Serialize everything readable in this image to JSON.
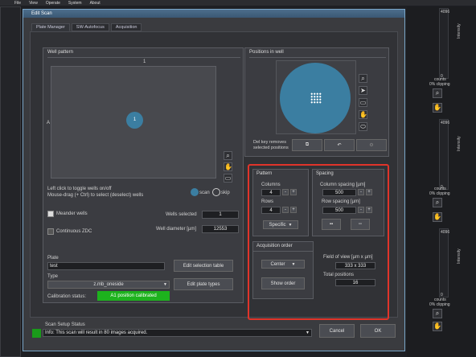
{
  "menu": [
    "File",
    "View",
    "Operate",
    "System",
    "About"
  ],
  "dialog_title": "Edit Scan",
  "tabs": [
    "Plate Manager",
    "SW-Autofocus",
    "Acquisition"
  ],
  "well_pattern": {
    "title": "Well pattern",
    "column_label": "1",
    "row_label": "A",
    "well_label": "1",
    "instructions_1": "Left click to toggle wells on/off",
    "instructions_2": "Mouse-drag (+ Ctrl) to select (deselect) wells",
    "scan_label": "scan",
    "skip_label": "skip",
    "meander_label": "Meander wells",
    "continuous_label": "Continuous ZDC",
    "wells_selected_label": "Wells selected",
    "wells_selected_value": "1",
    "well_diameter_label": "Well diameter [µm]",
    "well_diameter_value": "12553",
    "plate_label": "Plate",
    "plate_value": "test",
    "edit_selection_label": "Edit selection table",
    "type_label": "Type",
    "type_value": "z.mb_oneside",
    "edit_types_label": "Edit plate types",
    "calibration_label": "Calibration status:",
    "calibration_value": "A1 position calibrated"
  },
  "positions": {
    "title": "Positions in well",
    "del_note_1": "Del key removes",
    "del_note_2": "selected positions"
  },
  "pattern": {
    "title": "Pattern",
    "columns_label": "Columns",
    "columns_value": "4",
    "rows_label": "Rows",
    "rows_value": "4",
    "mode_value": "Specific"
  },
  "spacing": {
    "title": "Spacing",
    "column_spacing_label": "Column spacing [µm]",
    "column_spacing_value": "500",
    "row_spacing_label": "Row spacing [µm]",
    "row_spacing_value": "500"
  },
  "acq_order": {
    "title": "Acquisition order",
    "order_value": "Center",
    "show_order_label": "Show order"
  },
  "fov": {
    "fov_label": "Field of view [µm x µm]",
    "fov_value": "333 x 333",
    "total_label": "Total positions",
    "total_value": "16"
  },
  "status": {
    "title": "Scan Setup Status",
    "info": "Info: This scan will result in 80 images acquired."
  },
  "buttons": {
    "cancel": "Cancel",
    "ok": "OK"
  },
  "right_panels": {
    "top_value": "4096",
    "counts_label": "counts",
    "clipping_label": "0% clipping",
    "intensity_label": "Intensity",
    "low_value": "0"
  },
  "colors": {
    "accent_blue": "#3b7ea1",
    "highlight_red": "#e0342a",
    "calibration_green": "#1db21d",
    "status_green": "#1a9a1a"
  }
}
